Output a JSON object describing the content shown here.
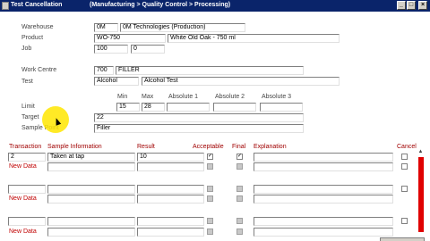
{
  "window": {
    "title": "Test Cancellation",
    "subtitle": "(Manufacturing > Quality Control > Processing)"
  },
  "form": {
    "warehouse_label": "Warehouse",
    "warehouse_code": "0M",
    "warehouse_name": "0M Technologies (Production)",
    "product_label": "Product",
    "product_code": "WO-750",
    "product_name": "White Old Oak - 750 ml",
    "job_label": "Job",
    "job_number": "100",
    "job_sub": "0",
    "work_centre_label": "Work Centre",
    "work_centre_code": "700",
    "work_centre_name": "FILLER",
    "test_label": "Test",
    "test_code": "Alcohol",
    "test_name": "Alcohol Test",
    "limit_label": "Limit",
    "min_label": "Min",
    "max_label": "Max",
    "abs1_label": "Absolute 1",
    "abs2_label": "Absolute 2",
    "abs3_label": "Absolute 3",
    "min_value": "15",
    "max_value": "28",
    "target_label": "Target",
    "target_value": "22",
    "sample_point_label": "Sample Point",
    "sample_point_value": "Filler"
  },
  "grid": {
    "headers": {
      "transaction": "Transaction",
      "sample_info": "Sample Information",
      "result": "Result",
      "acceptable": "Acceptable",
      "final": "Final",
      "explanation": "Explanation",
      "cancel": "Cancel"
    },
    "new_data_label": "New Data",
    "row1": {
      "transaction": "2",
      "sample_info": "Taken at tap",
      "result": "10",
      "acceptable_mark": "✓",
      "final_mark": "✓"
    }
  }
}
